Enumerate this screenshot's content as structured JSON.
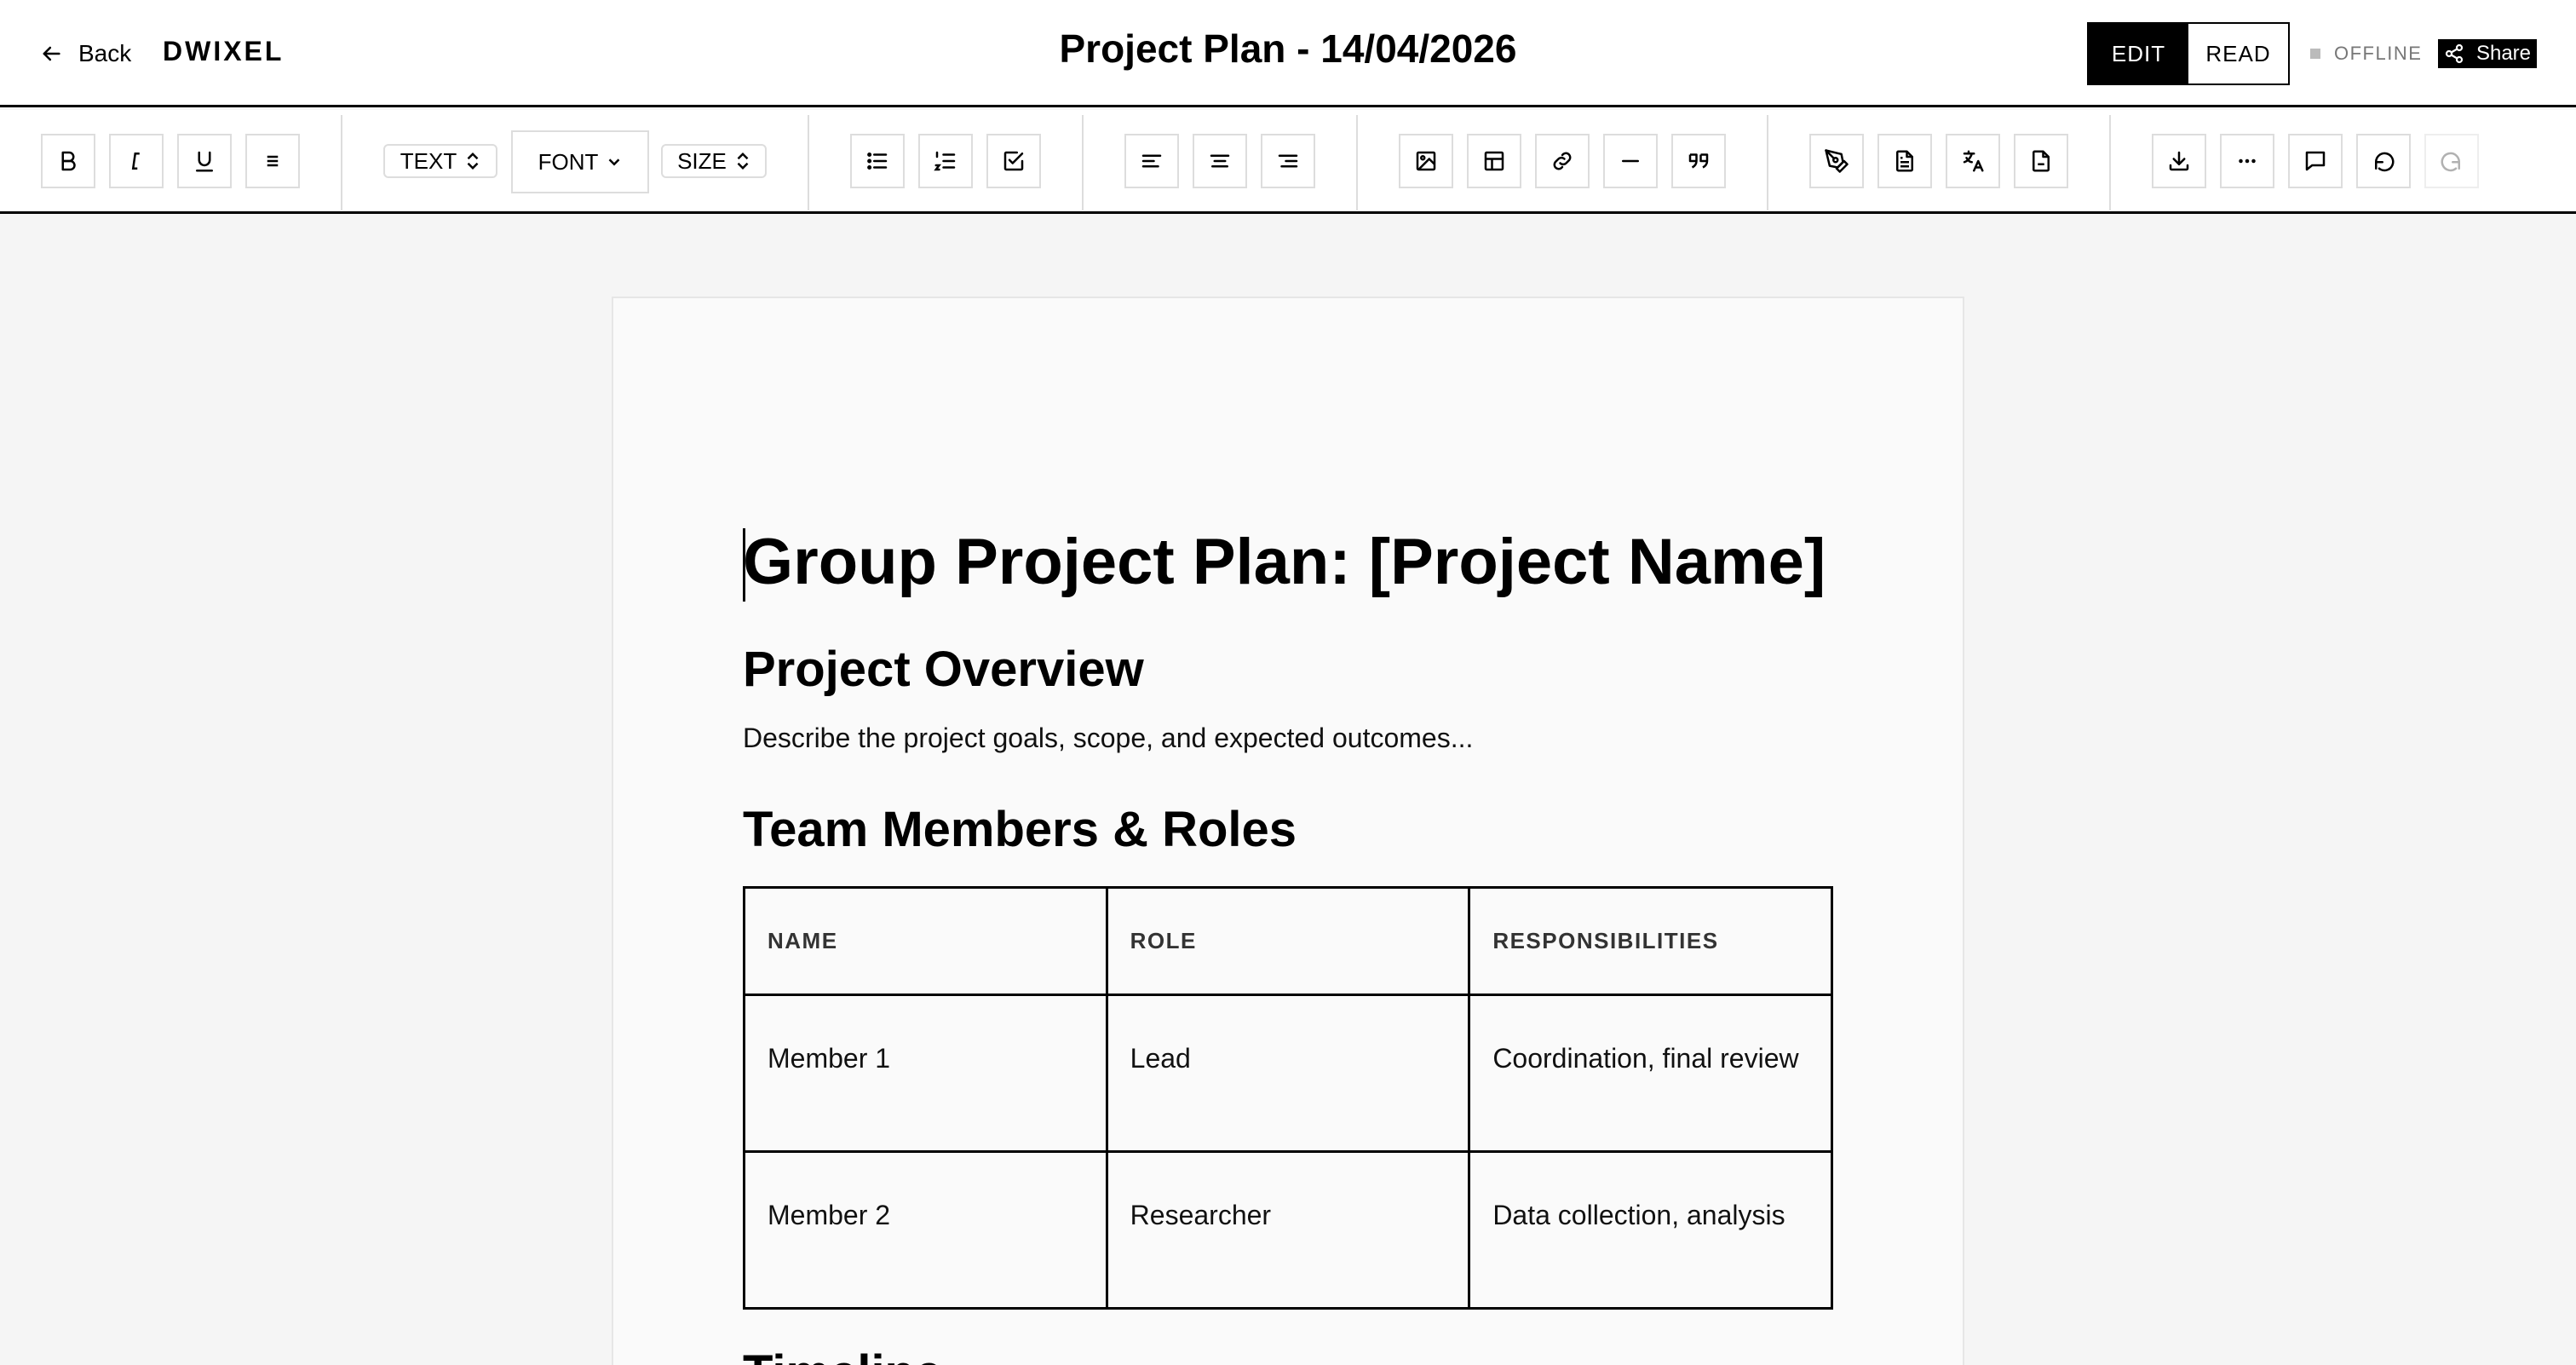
{
  "header": {
    "back_label": "Back",
    "brand": "DWIXEL",
    "title": "Project Plan - 14/04/2026",
    "modes": {
      "edit": "EDIT",
      "read": "READ",
      "active": "edit"
    },
    "status": "OFFLINE",
    "share_label": "Share"
  },
  "toolbar": {
    "format_buttons": [
      "bold-icon",
      "italic-icon",
      "underline-icon",
      "paragraph-menu-icon"
    ],
    "selects": {
      "text": "TEXT",
      "font": "FONT",
      "size": "SIZE"
    },
    "list_buttons": [
      "bullet-list-icon",
      "numbered-list-icon",
      "checklist-icon"
    ],
    "align_buttons": [
      "align-left-icon",
      "align-center-icon",
      "align-right-icon"
    ],
    "insert_buttons": [
      "image-icon",
      "table-icon",
      "link-icon",
      "horizontal-rule-icon",
      "quote-icon"
    ],
    "tool_buttons": [
      "pen-tool-icon",
      "document-icon",
      "translate-icon",
      "file-icon"
    ],
    "action_buttons": [
      "download-icon",
      "more-icon",
      "comment-icon",
      "undo-icon",
      "redo-icon"
    ]
  },
  "document": {
    "title": "Group Project Plan: [Project Name]",
    "overview_heading": "Project Overview",
    "overview_text": "Describe the project goals, scope, and expected outcomes...",
    "team_heading": "Team Members & Roles",
    "table": {
      "headers": [
        "NAME",
        "ROLE",
        "RESPONSIBILITIES"
      ],
      "rows": [
        [
          "Member 1",
          "Lead",
          "Coordination, final review"
        ],
        [
          "Member 2",
          "Researcher",
          "Data collection, analysis"
        ]
      ]
    },
    "next_heading": "Timeline"
  },
  "colors": {
    "accent": "#000000",
    "background": "#f5f5f5",
    "page": "#fafafa",
    "border_light": "#dddddd"
  }
}
